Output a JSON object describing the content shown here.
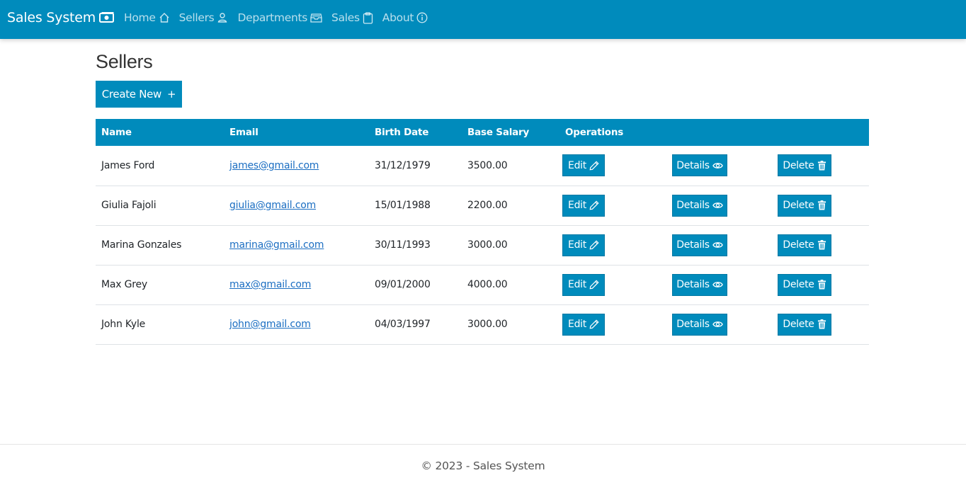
{
  "navbar": {
    "brand": "Sales System",
    "items": [
      {
        "label": "Home",
        "icon": "house-icon"
      },
      {
        "label": "Sellers",
        "icon": "person-icon"
      },
      {
        "label": "Departments",
        "icon": "inbox-stack-icon"
      },
      {
        "label": "Sales",
        "icon": "clipboard-icon"
      },
      {
        "label": "About",
        "icon": "info-circle-icon"
      }
    ]
  },
  "page": {
    "title": "Sellers",
    "create_label": "Create New",
    "create_icon": "+"
  },
  "table": {
    "headers": [
      "Name",
      "Email",
      "Birth Date",
      "Base Salary",
      "Operations"
    ],
    "rows": [
      {
        "name": "James Ford",
        "email": "james@gmail.com",
        "birth": "31/12/1979",
        "salary": "3500.00"
      },
      {
        "name": "Giulia Fajoli",
        "email": "giulia@gmail.com",
        "birth": "15/01/1988",
        "salary": "2200.00"
      },
      {
        "name": "Marina Gonzales",
        "email": "marina@gmail.com",
        "birth": "30/11/1993",
        "salary": "3000.00"
      },
      {
        "name": "Max Grey",
        "email": "max@gmail.com",
        "birth": "09/01/2000",
        "salary": "4000.00"
      },
      {
        "name": "John Kyle",
        "email": "john@gmail.com",
        "birth": "04/03/1997",
        "salary": "3000.00"
      }
    ],
    "actions": {
      "edit": "Edit",
      "details": "Details",
      "delete": "Delete"
    }
  },
  "footer": {
    "text": "© 2023 - Sales System"
  },
  "colors": {
    "primary": "#008bbc",
    "link": "#1b6ec2"
  }
}
